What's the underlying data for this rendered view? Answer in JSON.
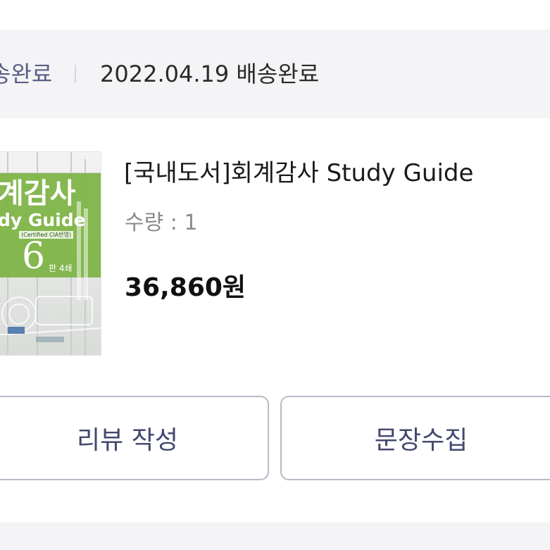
{
  "order": {
    "status_left": "송완료",
    "status_right": "2022.04.19 배송완료"
  },
  "product": {
    "cover_title_line1": "계감사",
    "cover_title_line2": "dy Guide",
    "cover_subtitle": "(Certified CIA반영)",
    "cover_edition": "6",
    "cover_edition_suffix": "판 4쇄",
    "title": "[국내도서]회계감사 Study Guide",
    "quantity_text": "수량 : 1",
    "price_text": "36,860원"
  },
  "actions": {
    "review_label": "리뷰 작성",
    "collect_label": "문장수집"
  },
  "colors": {
    "status_bg": "#f4f4f7",
    "button_border": "#b8bac6",
    "button_text": "#44486e",
    "cover_green": "#7cb342"
  }
}
